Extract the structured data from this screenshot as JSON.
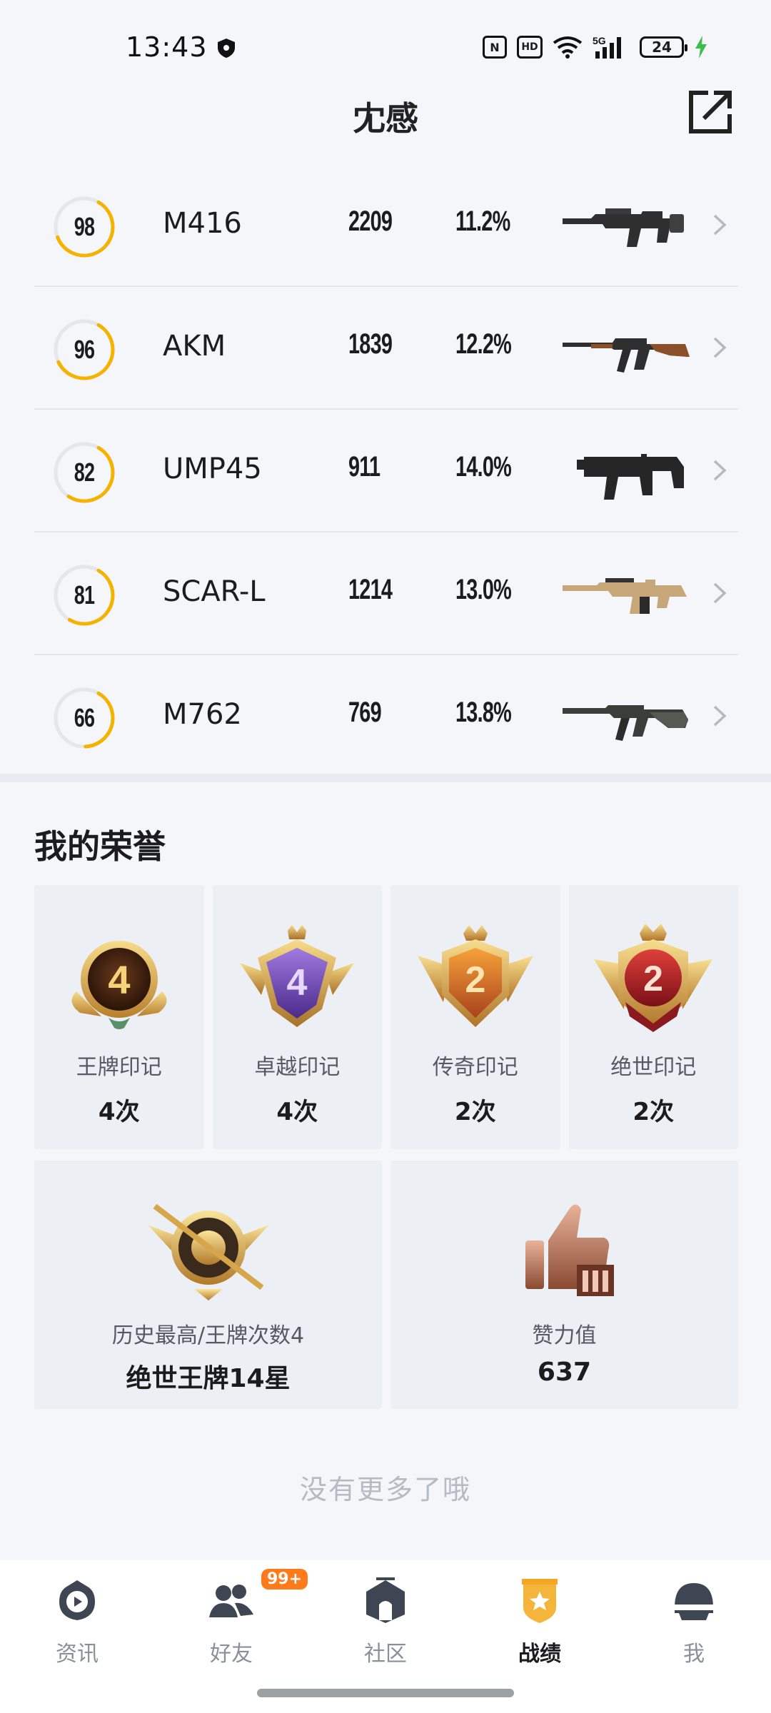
{
  "status_bar": {
    "time": "13:43",
    "battery": "24",
    "icons": [
      "shield-icon",
      "nfc-icon",
      "hd-icon",
      "wifi-icon",
      "5g-signal-icon",
      "battery-icon",
      "charging-icon"
    ],
    "hd_label": "HD",
    "nfc_label": "N",
    "signal_label": "5G"
  },
  "header": {
    "title": "冘感"
  },
  "weapons": [
    {
      "score": "98",
      "score_pct": 0.98,
      "name": "M416",
      "kills": "2209",
      "rate": "11.2%",
      "gun": "m416"
    },
    {
      "score": "96",
      "score_pct": 0.96,
      "name": "AKM",
      "kills": "1839",
      "rate": "12.2%",
      "gun": "akm"
    },
    {
      "score": "82",
      "score_pct": 0.82,
      "name": "UMP45",
      "kills": "911",
      "rate": "14.0%",
      "gun": "ump45"
    },
    {
      "score": "81",
      "score_pct": 0.81,
      "name": "SCAR-L",
      "kills": "1214",
      "rate": "13.0%",
      "gun": "scarl"
    },
    {
      "score": "66",
      "score_pct": 0.66,
      "name": "M762",
      "kills": "769",
      "rate": "13.8%",
      "gun": "m762"
    }
  ],
  "honor": {
    "title": "我的荣誉",
    "cards": [
      {
        "label": "王牌印记",
        "count": "4次",
        "badge_number": "4"
      },
      {
        "label": "卓越印记",
        "count": "4次",
        "badge_number": "4"
      },
      {
        "label": "传奇印记",
        "count": "2次",
        "badge_number": "2"
      },
      {
        "label": "绝世印记",
        "count": "2次",
        "badge_number": "2"
      }
    ],
    "history": {
      "label": "历史最高/王牌次数4",
      "value": "绝世王牌14星"
    },
    "likes": {
      "label": "赞力值",
      "value": "637"
    }
  },
  "footer_note": "没有更多了哦",
  "nav": {
    "items": [
      {
        "label": "资讯",
        "icon": "news-play-icon",
        "active": false
      },
      {
        "label": "好友",
        "icon": "friends-icon",
        "active": false,
        "badge": "99+"
      },
      {
        "label": "社区",
        "icon": "community-icon",
        "active": false
      },
      {
        "label": "战绩",
        "icon": "record-shield-icon",
        "active": true
      },
      {
        "label": "我",
        "icon": "helmet-icon",
        "active": false
      }
    ]
  },
  "colors": {
    "accent": "#f5b300",
    "ring_track": "#e4e6ea",
    "background": "#f4f6fa",
    "card": "#eceff4",
    "nav_active": "#f5a623"
  }
}
